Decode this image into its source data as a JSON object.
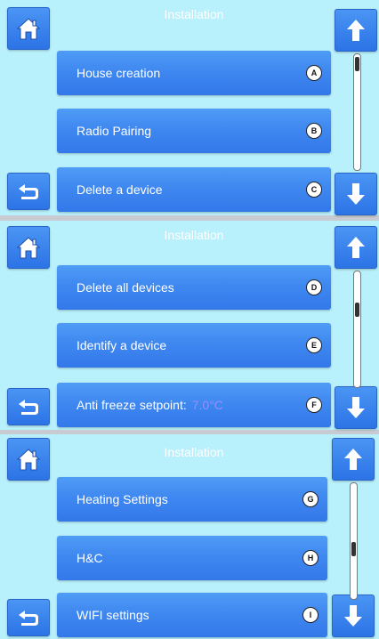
{
  "screens": [
    {
      "title": "Installation",
      "items": [
        {
          "label": "House creation",
          "badge": "A"
        },
        {
          "label": "Radio Pairing",
          "badge": "B"
        },
        {
          "label": "Delete a device",
          "badge": "C"
        }
      ]
    },
    {
      "title": "Installation",
      "items": [
        {
          "label": "Delete all devices",
          "badge": "D"
        },
        {
          "label": "Identify a device",
          "badge": "E"
        },
        {
          "label": "Anti freeze setpoint:",
          "value": "7.0°C",
          "badge": "F"
        }
      ]
    },
    {
      "title": "Installation",
      "items": [
        {
          "label": "Heating Settings",
          "badge": "G"
        },
        {
          "label": "H&C",
          "badge": "H"
        },
        {
          "label": "WIFI settings",
          "badge": "I"
        }
      ]
    }
  ],
  "colors": {
    "panel_bg": "#b8f0fb",
    "button_blue": "#3f88f0",
    "value_text": "#9a8cff"
  },
  "icons": {
    "home": "home-icon",
    "back": "back-arrow-icon",
    "up": "arrow-up-icon",
    "down": "arrow-down-icon"
  }
}
